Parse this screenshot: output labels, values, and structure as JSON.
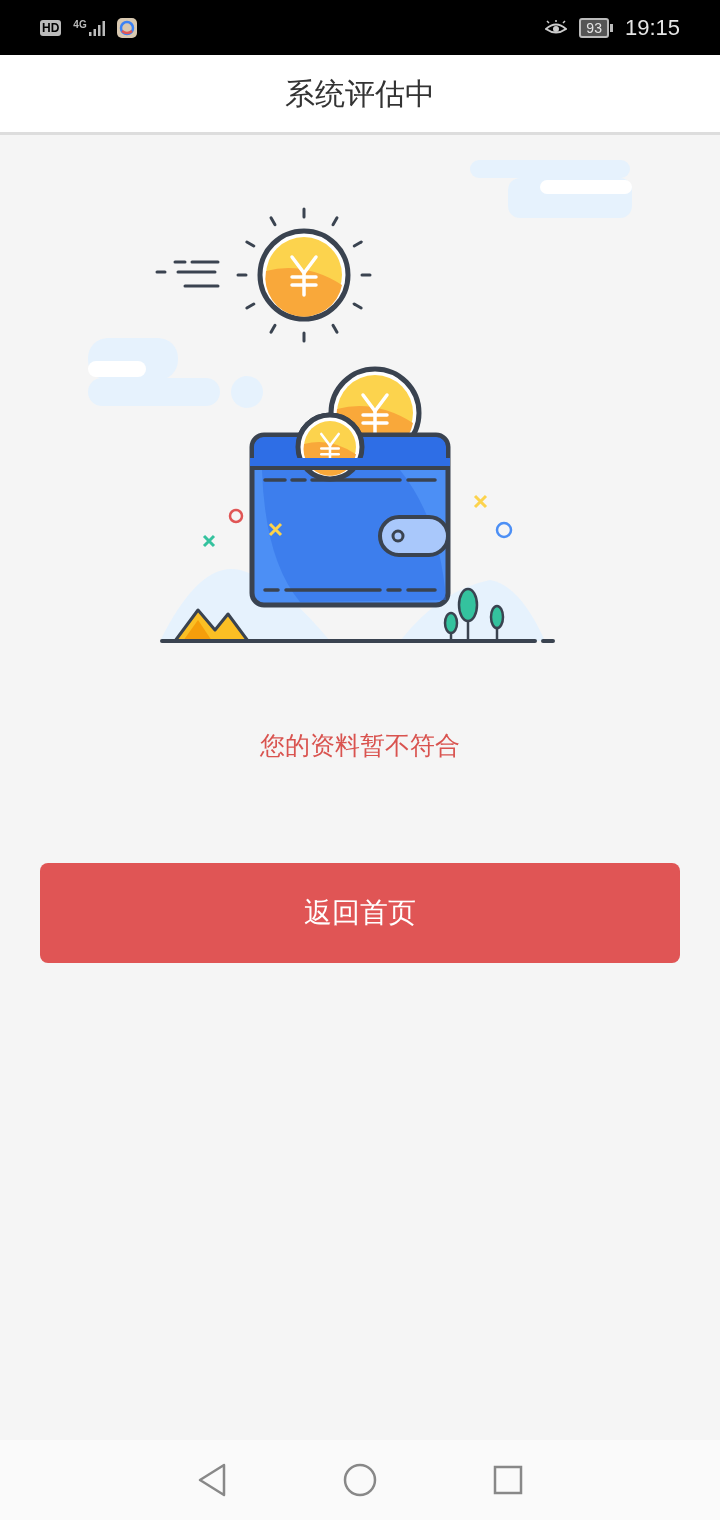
{
  "status_bar": {
    "network_badge": "HD",
    "network_type": "4G",
    "battery": "93",
    "time": "19:15"
  },
  "header": {
    "title": "系统评估中"
  },
  "message": "您的资料暂不符合",
  "button": {
    "label": "返回首页"
  }
}
